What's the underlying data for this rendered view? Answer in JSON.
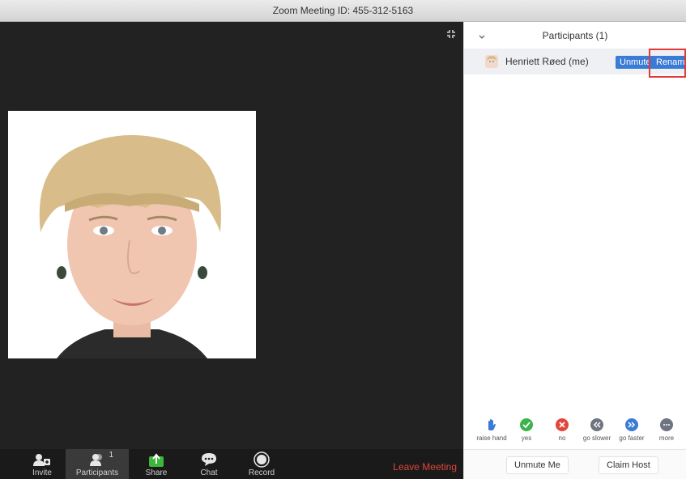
{
  "window": {
    "title": "Zoom Meeting ID: 455-312-5163"
  },
  "toolbar": {
    "invite": "Invite",
    "participants": "Participants",
    "participants_count": "1",
    "share": "Share",
    "chat": "Chat",
    "record": "Record",
    "leave": "Leave Meeting"
  },
  "panel": {
    "title": "Participants (1)",
    "participant": {
      "name": "Henriett Røed (me)",
      "unmute": "Unmute",
      "rename": "Rename"
    },
    "reactions": [
      "raise hand",
      "yes",
      "no",
      "go slower",
      "go faster",
      "more"
    ],
    "footer": {
      "unmute_me": "Unmute Me",
      "claim_host": "Claim Host"
    }
  },
  "colors": {
    "accent": "#3a7bd5",
    "leave": "#e0463b",
    "highlight": "#e03a3a"
  }
}
